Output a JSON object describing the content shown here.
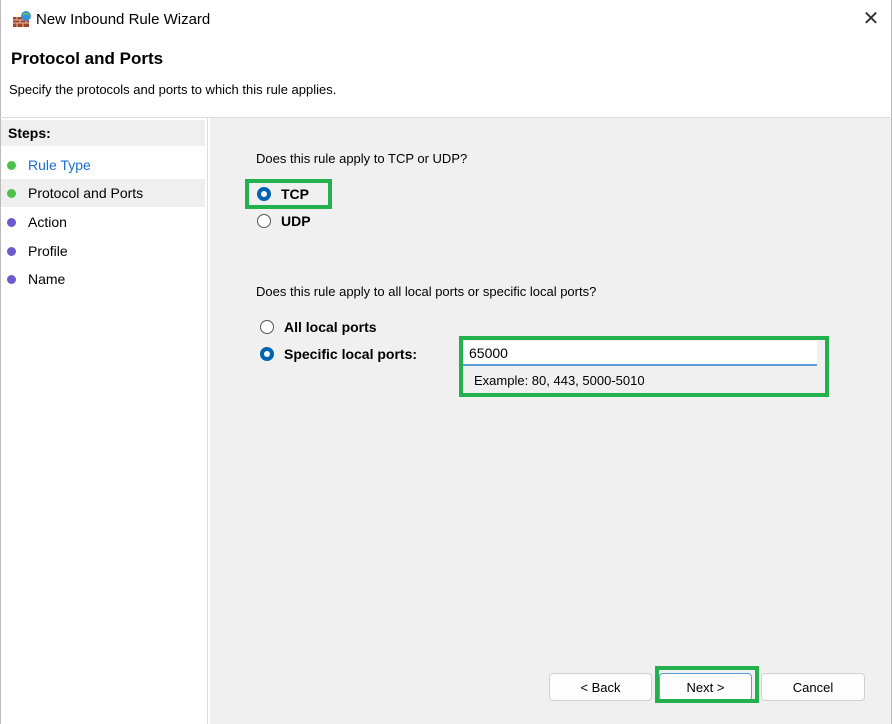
{
  "window": {
    "title": "New Inbound Rule Wizard",
    "icon": "firewall-icon",
    "close_label": "✕"
  },
  "header": {
    "title": "Protocol and Ports",
    "subtitle": "Specify the protocols and ports to which this rule applies."
  },
  "steps": {
    "heading": "Steps:",
    "items": [
      {
        "label": "Rule Type",
        "state": "done",
        "color": "#1a6fd1"
      },
      {
        "label": "Protocol and Ports",
        "state": "current",
        "color": "#000000"
      },
      {
        "label": "Action",
        "state": "pending",
        "color": "#000000"
      },
      {
        "label": "Profile",
        "state": "pending",
        "color": "#000000"
      },
      {
        "label": "Name",
        "state": "pending",
        "color": "#000000"
      }
    ]
  },
  "protocol": {
    "question": "Does this rule apply to TCP or UDP?",
    "options": [
      {
        "label": "TCP",
        "selected": true
      },
      {
        "label": "UDP",
        "selected": false
      }
    ]
  },
  "ports": {
    "question": "Does this rule apply to all local ports or specific local ports?",
    "options": [
      {
        "label": "All local ports",
        "selected": false
      },
      {
        "label": "Specific local ports:",
        "selected": true
      }
    ],
    "value": "65000",
    "hint": "Example: 80, 443, 5000-5010"
  },
  "buttons": {
    "back": "< Back",
    "next": "Next >",
    "cancel": "Cancel"
  },
  "colors": {
    "highlight": "#22b14c",
    "radio_selected": "#0063b1",
    "step_done": "#4cc24c",
    "step_pending": "#6a5acd"
  }
}
